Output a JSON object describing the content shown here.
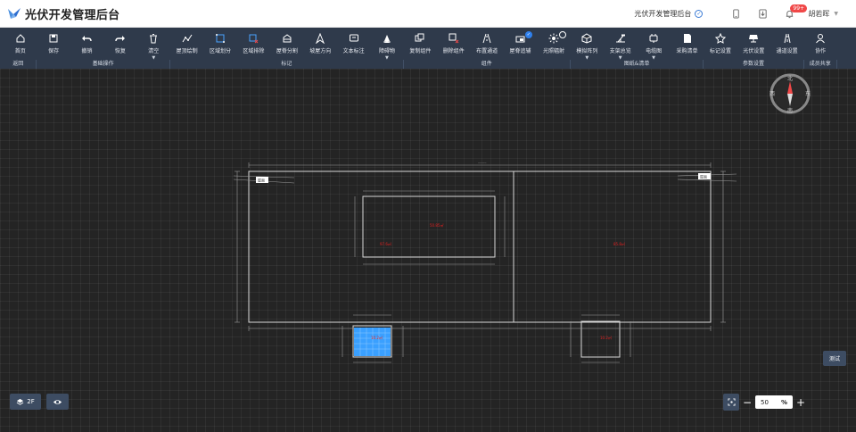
{
  "app": {
    "title": "光伏开发管理后台",
    "tenant": "光伏开发管理后台",
    "notification_count": "99+",
    "user": "胡若晖"
  },
  "toolbar": {
    "tools": [
      {
        "id": "home",
        "label": "首页",
        "icon": "home-icon"
      },
      {
        "id": "save",
        "label": "保存",
        "icon": "save-icon"
      },
      {
        "id": "undo",
        "label": "撤销",
        "icon": "undo-icon"
      },
      {
        "id": "redo",
        "label": "恢复",
        "icon": "redo-icon"
      },
      {
        "id": "clear",
        "label": "清空",
        "icon": "trash-icon",
        "dropdown": true
      },
      {
        "id": "roof-draw",
        "label": "屋顶绘制",
        "icon": "polyline-icon"
      },
      {
        "id": "area-divide",
        "label": "区域划分",
        "icon": "area-icon"
      },
      {
        "id": "area-remove",
        "label": "区域排除",
        "icon": "area-remove-icon"
      },
      {
        "id": "roof-split",
        "label": "屋脊分割",
        "icon": "roof-split-icon"
      },
      {
        "id": "roof-direction",
        "label": "坡屋方向",
        "icon": "direction-icon"
      },
      {
        "id": "text-note",
        "label": "文本标注",
        "icon": "text-note-icon"
      },
      {
        "id": "obstacle",
        "label": "障碍物",
        "icon": "obstacle-icon",
        "dropdown": true
      },
      {
        "id": "copy-comp",
        "label": "复制组件",
        "icon": "copy-icon"
      },
      {
        "id": "delete-comp",
        "label": "删除组件",
        "icon": "delete-component-icon"
      },
      {
        "id": "layout-channel",
        "label": "布置通道",
        "icon": "channel-icon"
      },
      {
        "id": "roof-solar",
        "label": "屋脊追辅",
        "icon": "roof-aux-icon",
        "badge": "check"
      },
      {
        "id": "irradiance",
        "label": "光照辐射",
        "icon": "sun-icon",
        "badge": "ring"
      },
      {
        "id": "module-arrange",
        "label": "模拟阵列",
        "icon": "module-icon",
        "dropdown": true
      },
      {
        "id": "bracket",
        "label": "支架总览",
        "icon": "bracket-icon",
        "dropdown": true
      },
      {
        "id": "cable",
        "label": "电缆图",
        "icon": "cable-icon",
        "dropdown": true
      },
      {
        "id": "purchase",
        "label": "采购清单",
        "icon": "document-icon"
      },
      {
        "id": "mark-settings",
        "label": "标记设置",
        "icon": "star-icon"
      },
      {
        "id": "pv-settings",
        "label": "光伏设置",
        "icon": "pv-panel-icon"
      },
      {
        "id": "channel-settings",
        "label": "通道设置",
        "icon": "road-icon"
      },
      {
        "id": "collab",
        "label": "协作",
        "icon": "user-icon"
      }
    ],
    "groups": [
      {
        "label": "返回",
        "span": 1
      },
      {
        "label": "基础操作",
        "span": 4
      },
      {
        "label": "标记",
        "span": 7
      },
      {
        "label": "组件",
        "span": 5
      },
      {
        "label": "图纸&清单",
        "span": 4
      },
      {
        "label": "参数设置",
        "span": 3
      },
      {
        "label": "成员共享",
        "span": 1
      }
    ]
  },
  "canvas": {
    "compass": {
      "north": "北",
      "south": "南",
      "east": "东",
      "west": "西"
    },
    "roof_labels": [
      {
        "id": "left-inner",
        "text": "50.85㎡",
        "color": "#e02020"
      },
      {
        "id": "left-room",
        "text": "97.6㎡",
        "color": "#e02020"
      },
      {
        "id": "right-room",
        "text": "85.8㎡",
        "color": "#e02020"
      },
      {
        "id": "panel-block",
        "text": "10.2㎡",
        "color": "#e02020"
      },
      {
        "id": "small-right",
        "text": "10.2㎡",
        "color": "#e02020"
      }
    ],
    "tag_left": "屋面",
    "tag_right": "屋面"
  },
  "controls": {
    "test_button": "测试",
    "floor": "2F",
    "zoom_value": "50",
    "zoom_unit": "%"
  },
  "colors": {
    "toolbar_bg": "#2f3a4b",
    "canvas_bg": "#242424",
    "accent": "#2f80ed",
    "panel_fill": "#3aa0ff",
    "badge": "#f04848"
  }
}
